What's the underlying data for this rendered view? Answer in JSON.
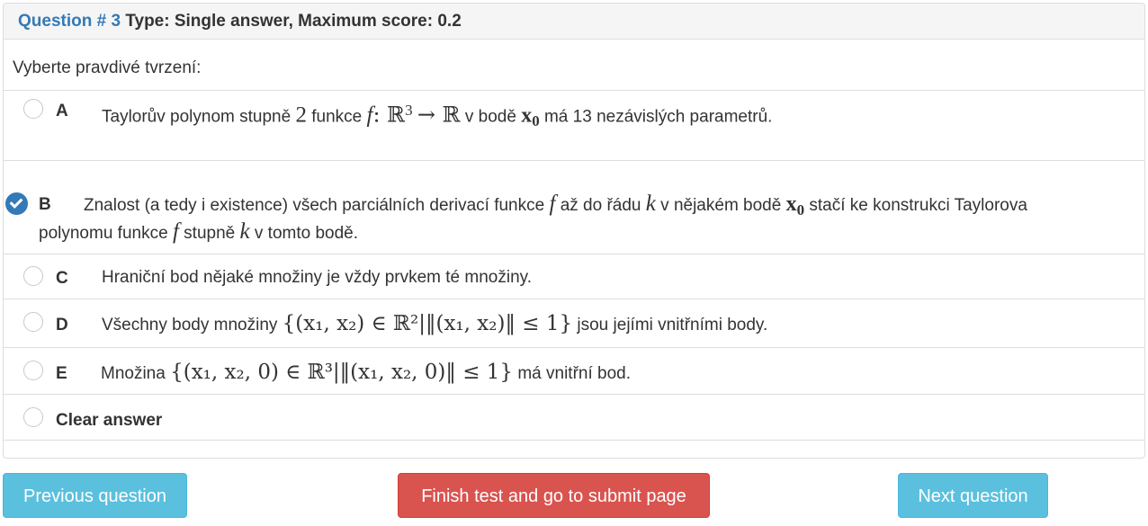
{
  "question": {
    "number_label": "Question # 3",
    "type_label": "Type: Single answer, Maximum score: 0.2",
    "prompt": "Vyberte pravdivé tvrzení:"
  },
  "options": [
    {
      "letter": "A",
      "t1": "Taylorův polynom stupně",
      "m1": "2",
      "t2": "funkce",
      "m2": "f",
      "m3": ": ℝ",
      "sup1": "3",
      "m4": "→ ℝ",
      "t3": "v bodě",
      "m5": "x",
      "sub1": "0",
      "t4": "má 13 nezávislých parametrů.",
      "selected": false
    },
    {
      "letter": "B",
      "t1": "Znalost (a tedy i existence) všech parciálních derivací funkce",
      "m1": "f",
      "t2": "až do řádu",
      "m2": "k",
      "t3": "v nějakém bodě",
      "m3": "x",
      "sub1": "0",
      "t4": "stačí ke konstrukci Taylorova",
      "t5": "polynomu funkce",
      "m4": "f",
      "t6": "stupně",
      "m5": "k",
      "t7": "v tomto bodě.",
      "selected": true
    },
    {
      "letter": "C",
      "t1": "Hraniční bod nějaké množiny je vždy prvkem té množiny.",
      "selected": false
    },
    {
      "letter": "D",
      "t1": "Všechny body množiny",
      "math": "{(x₁, x₂) ∈ ℝ²|‖(x₁, x₂)‖ ≤ 1}",
      "t2": "jsou jejími vnitřními body.",
      "selected": false
    },
    {
      "letter": "E",
      "t1": "Množina",
      "math": "{(x₁, x₂, 0) ∈ ℝ³|‖(x₁, x₂, 0)‖ ≤ 1}",
      "t2": "má vnitřní bod.",
      "selected": false
    }
  ],
  "clear_answer": "Clear answer",
  "buttons": {
    "previous": "Previous question",
    "finish": "Finish test and go to submit page",
    "next": "Next question"
  },
  "colors": {
    "link_blue": "#337ab7",
    "info": "#5bc0de",
    "danger": "#d9534f"
  }
}
